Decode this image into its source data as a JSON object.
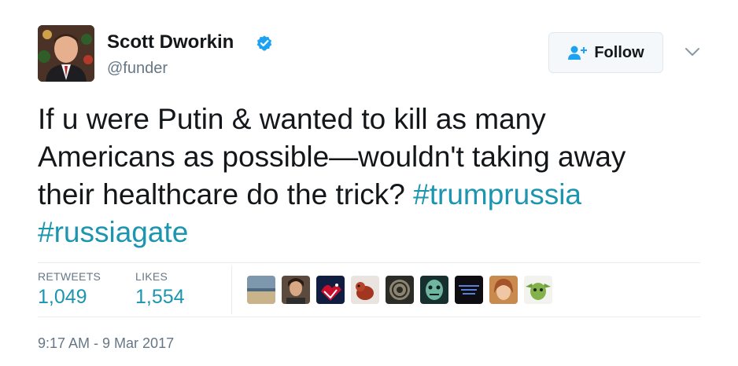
{
  "tweet": {
    "user_name": "Scott Dworkin",
    "handle": "@funder",
    "verified_icon": "verified-badge-icon",
    "follow_label": "Follow",
    "text_lines": [
      "If u were Putin & wanted to kill as many",
      "Americans as possible—wouldn't taking away",
      "their healthcare do the trick?"
    ],
    "hashtags": [
      "#trumprussia",
      "#russiagate"
    ],
    "stats": {
      "retweets_label": "RETWEETS",
      "retweets_value": "1,049",
      "likes_label": "LIKES",
      "likes_value": "1,554"
    },
    "timestamp": "9:17 AM - 9 Mar 2017"
  },
  "colors": {
    "link": "#1b95b0",
    "verified": "#1da1f2",
    "muted_text": "#657786",
    "border": "#e6ecf0"
  }
}
